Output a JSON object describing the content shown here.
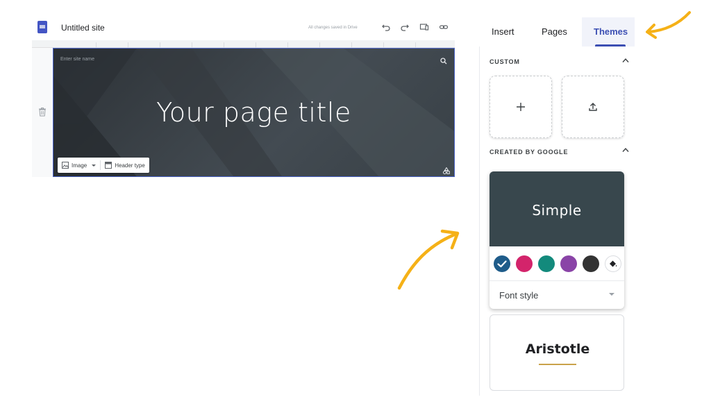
{
  "editor": {
    "doc_title": "Untitled site",
    "save_status": "All changes saved in Drive",
    "header": {
      "site_name_placeholder": "Enter site name",
      "page_title": "Your page title",
      "toolbar": {
        "image_label": "Image",
        "header_type_label": "Header type"
      }
    }
  },
  "panel": {
    "tabs": [
      "Insert",
      "Pages",
      "Themes"
    ],
    "active_tab": "Themes",
    "sections": {
      "custom": "CUSTOM",
      "created_by_google": "CREATED BY GOOGLE"
    },
    "themes": [
      {
        "name": "Simple",
        "color_swatches": [
          "#1f5c8a",
          "#d3246b",
          "#138a7c",
          "#8a44a7",
          "#333333"
        ],
        "selected_swatch": 0,
        "font_style_label": "Font style"
      },
      {
        "name": "Aristotle"
      }
    ]
  },
  "colors": {
    "accent": "#3c4fb3",
    "annotation_arrow": "#f5b117",
    "simple_preview": "#38474d"
  },
  "icons": [
    "sites-logo-icon",
    "undo-icon",
    "redo-icon",
    "preview-icon",
    "link-icon",
    "trash-icon",
    "search-icon",
    "image-icon",
    "header-type-icon",
    "shapes-icon",
    "chevron-up-icon",
    "add-icon",
    "upload-icon",
    "check-icon",
    "paint-bucket-icon"
  ]
}
